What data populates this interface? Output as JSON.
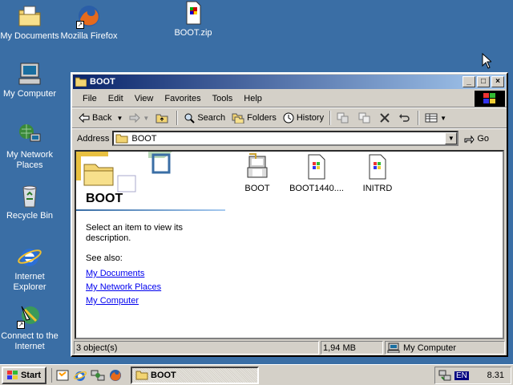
{
  "desktop": {
    "icons": [
      {
        "label": "My Documents"
      },
      {
        "label": "Mozilla Firefox"
      },
      {
        "label": "BOOT.zip"
      },
      {
        "label": "My Computer"
      },
      {
        "label": "My Network Places"
      },
      {
        "label": "Recycle Bin"
      },
      {
        "label": "Internet Explorer"
      },
      {
        "label": "Connect to the Internet"
      }
    ]
  },
  "window": {
    "title": "BOOT",
    "menu": [
      "File",
      "Edit",
      "View",
      "Favorites",
      "Tools",
      "Help"
    ],
    "toolbar": {
      "back": "Back",
      "search": "Search",
      "folders": "Folders",
      "history": "History"
    },
    "address": {
      "label": "Address",
      "value": "BOOT",
      "go": "Go"
    },
    "left_pane": {
      "title": "BOOT",
      "description": "Select an item to view its description.",
      "see_also": "See also:",
      "links": [
        "My Documents",
        "My Network Places",
        "My Computer"
      ]
    },
    "files": [
      {
        "name": "BOOT",
        "icon": "batch-file-icon"
      },
      {
        "name": "BOOT1440....",
        "icon": "system-file-icon"
      },
      {
        "name": "INITRD",
        "icon": "system-file-icon"
      }
    ],
    "status": {
      "objects": "3 object(s)",
      "size": "1,94 MB",
      "location": "My Computer"
    }
  },
  "taskbar": {
    "start": "Start",
    "task": "BOOT",
    "lang": "EN",
    "clock": "8.31"
  },
  "colors": {
    "desktop": "#3a6ea5",
    "title_active": "#0a246a",
    "face": "#d4d0c8",
    "link": "#0000ee"
  }
}
